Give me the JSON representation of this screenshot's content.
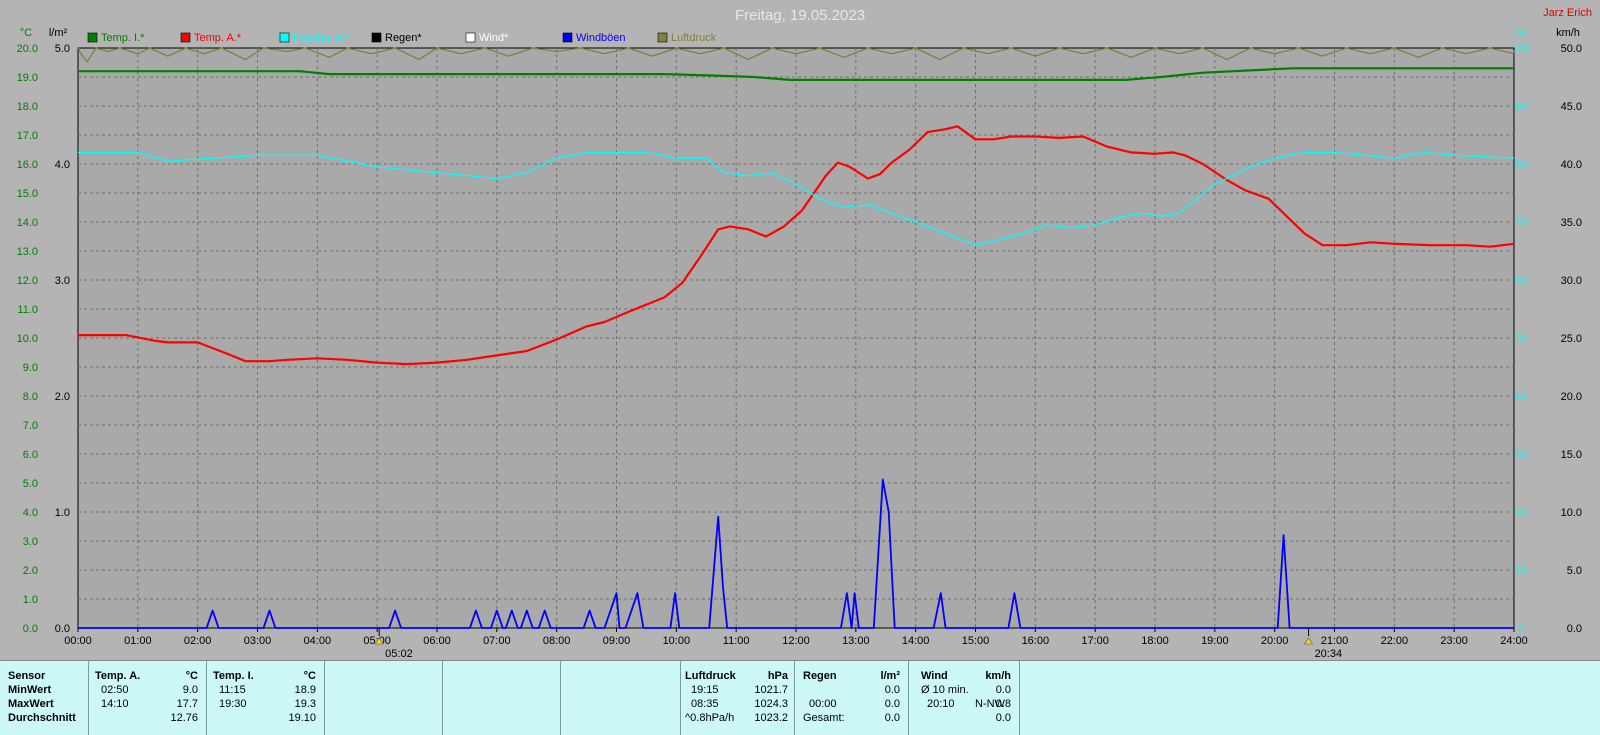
{
  "title": "Freitag, 19.05.2023",
  "credit": "Jarz Erich",
  "units": {
    "left_outer": "°C",
    "left_inner": "l/m²",
    "right_inner": "%",
    "right_outer": "km/h"
  },
  "legend": [
    {
      "label": "Temp. I.*",
      "color": "#008000"
    },
    {
      "label": "Temp. A.*",
      "color": "#ff0000"
    },
    {
      "label": "Feuchte A.*",
      "color": "#00ffff"
    },
    {
      "label": "Regen*",
      "color": "#000000"
    },
    {
      "label": "Wind*",
      "color": "#ffffff"
    },
    {
      "label": "Windböen",
      "color": "#0000ff"
    },
    {
      "label": "Luftdruck",
      "color": "#808040"
    }
  ],
  "markers": {
    "sunrise": "05:02",
    "sunset": "20:34"
  },
  "chart_data": {
    "type": "line",
    "x_unit": "hours",
    "xlim": [
      0,
      24
    ],
    "x_ticks": [
      "00:00",
      "01:00",
      "02:00",
      "03:00",
      "04:00",
      "05:00",
      "06:00",
      "07:00",
      "08:00",
      "09:00",
      "10:00",
      "11:00",
      "12:00",
      "13:00",
      "14:00",
      "15:00",
      "16:00",
      "17:00",
      "18:00",
      "19:00",
      "20:00",
      "21:00",
      "22:00",
      "23:00",
      "24:00"
    ],
    "axes": {
      "temp": {
        "unit": "°C",
        "ylim": [
          0,
          20
        ],
        "ticks": [
          "0.0",
          "1.0",
          "2.0",
          "3.0",
          "4.0",
          "5.0",
          "6.0",
          "7.0",
          "8.0",
          "9.0",
          "10.0",
          "11.0",
          "12.0",
          "13.0",
          "14.0",
          "15.0",
          "16.0",
          "17.0",
          "18.0",
          "19.0",
          "20.0"
        ]
      },
      "rain": {
        "unit": "l/m²",
        "ylim": [
          0,
          5
        ],
        "ticks": [
          "0.0",
          "1.0",
          "2.0",
          "3.0",
          "4.0",
          "5.0"
        ]
      },
      "humidity": {
        "unit": "%",
        "ylim": [
          0,
          100
        ],
        "ticks": [
          "0",
          "10",
          "20",
          "30",
          "40",
          "50",
          "60",
          "70",
          "80",
          "90",
          "100"
        ]
      },
      "wind": {
        "unit": "km/h",
        "ylim": [
          0,
          50
        ],
        "ticks": [
          "0.0",
          "5.0",
          "10.0",
          "15.0",
          "20.0",
          "25.0",
          "30.0",
          "35.0",
          "40.0",
          "45.0",
          "50.0"
        ]
      }
    },
    "grid": true,
    "series": [
      {
        "name": "Temp. I.*",
        "axis": "temp",
        "color": "#008000",
        "points": [
          [
            0,
            19.2
          ],
          [
            3.7,
            19.2
          ],
          [
            4.2,
            19.1
          ],
          [
            9.8,
            19.1
          ],
          [
            10.6,
            19.05
          ],
          [
            11.3,
            19.0
          ],
          [
            11.9,
            18.9
          ],
          [
            17.5,
            18.9
          ],
          [
            18.1,
            19.0
          ],
          [
            18.8,
            19.15
          ],
          [
            20.3,
            19.3
          ],
          [
            24,
            19.3
          ]
        ]
      },
      {
        "name": "Temp. A.*",
        "axis": "temp",
        "color": "#ff0000",
        "points": [
          [
            0,
            10.1
          ],
          [
            0.8,
            10.1
          ],
          [
            1.3,
            9.9
          ],
          [
            1.5,
            9.85
          ],
          [
            2.0,
            9.85
          ],
          [
            2.5,
            9.45
          ],
          [
            2.8,
            9.2
          ],
          [
            3.2,
            9.2
          ],
          [
            3.5,
            9.25
          ],
          [
            4.0,
            9.3
          ],
          [
            4.5,
            9.25
          ],
          [
            5.0,
            9.15
          ],
          [
            5.5,
            9.1
          ],
          [
            6.0,
            9.15
          ],
          [
            6.5,
            9.25
          ],
          [
            7.0,
            9.4
          ],
          [
            7.5,
            9.55
          ],
          [
            8.0,
            9.95
          ],
          [
            8.5,
            10.4
          ],
          [
            8.8,
            10.55
          ],
          [
            9.2,
            10.9
          ],
          [
            9.5,
            11.15
          ],
          [
            9.8,
            11.4
          ],
          [
            10.1,
            11.9
          ],
          [
            10.4,
            12.8
          ],
          [
            10.7,
            13.75
          ],
          [
            10.9,
            13.85
          ],
          [
            11.2,
            13.75
          ],
          [
            11.5,
            13.5
          ],
          [
            11.8,
            13.85
          ],
          [
            12.1,
            14.4
          ],
          [
            12.5,
            15.6
          ],
          [
            12.7,
            16.05
          ],
          [
            12.9,
            15.9
          ],
          [
            13.2,
            15.5
          ],
          [
            13.4,
            15.65
          ],
          [
            13.6,
            16.05
          ],
          [
            13.9,
            16.5
          ],
          [
            14.2,
            17.1
          ],
          [
            14.5,
            17.2
          ],
          [
            14.7,
            17.3
          ],
          [
            15.0,
            16.85
          ],
          [
            15.3,
            16.85
          ],
          [
            15.6,
            16.95
          ],
          [
            16.0,
            16.95
          ],
          [
            16.4,
            16.9
          ],
          [
            16.8,
            16.95
          ],
          [
            17.2,
            16.6
          ],
          [
            17.6,
            16.4
          ],
          [
            18.0,
            16.35
          ],
          [
            18.3,
            16.4
          ],
          [
            18.5,
            16.3
          ],
          [
            18.8,
            16.0
          ],
          [
            19.2,
            15.45
          ],
          [
            19.5,
            15.1
          ],
          [
            19.9,
            14.8
          ],
          [
            20.2,
            14.2
          ],
          [
            20.5,
            13.6
          ],
          [
            20.8,
            13.2
          ],
          [
            21.2,
            13.2
          ],
          [
            21.6,
            13.3
          ],
          [
            22.0,
            13.25
          ],
          [
            22.6,
            13.2
          ],
          [
            23.2,
            13.2
          ],
          [
            23.6,
            13.15
          ],
          [
            24.0,
            13.25
          ]
        ]
      },
      {
        "name": "Feuchte A.*",
        "axis": "humidity",
        "color": "#00ffff",
        "points": [
          [
            0,
            82
          ],
          [
            1.0,
            82
          ],
          [
            1.5,
            80.5
          ],
          [
            3.0,
            81.5
          ],
          [
            4.0,
            81.5
          ],
          [
            5.0,
            79.5
          ],
          [
            6.0,
            78.5
          ],
          [
            6.5,
            78
          ],
          [
            7.0,
            77.5
          ],
          [
            7.5,
            78.5
          ],
          [
            8.0,
            81
          ],
          [
            8.5,
            82
          ],
          [
            9.0,
            82
          ],
          [
            9.5,
            82
          ],
          [
            10.0,
            81
          ],
          [
            10.5,
            81
          ],
          [
            10.8,
            78.5
          ],
          [
            11.2,
            78
          ],
          [
            11.6,
            78.5
          ],
          [
            12.0,
            76.5
          ],
          [
            12.4,
            74
          ],
          [
            12.8,
            72.5
          ],
          [
            13.2,
            73
          ],
          [
            13.6,
            71.5
          ],
          [
            14.0,
            70
          ],
          [
            14.5,
            68
          ],
          [
            15.0,
            66
          ],
          [
            15.4,
            67
          ],
          [
            15.8,
            68
          ],
          [
            16.2,
            69.5
          ],
          [
            16.6,
            69
          ],
          [
            17.0,
            69.5
          ],
          [
            17.5,
            71
          ],
          [
            17.8,
            71.5
          ],
          [
            18.1,
            71
          ],
          [
            18.4,
            71.5
          ],
          [
            18.7,
            74
          ],
          [
            19.0,
            76.5
          ],
          [
            19.3,
            78
          ],
          [
            19.6,
            79.5
          ],
          [
            20.0,
            81
          ],
          [
            20.5,
            82
          ],
          [
            21.0,
            82
          ],
          [
            21.5,
            81.5
          ],
          [
            22.0,
            81
          ],
          [
            22.5,
            82
          ],
          [
            23.0,
            81.5
          ],
          [
            24.0,
            81
          ]
        ]
      },
      {
        "name": "Luftdruck",
        "axis": "rain",
        "color": "#808040",
        "points": [
          [
            0,
            5.0
          ],
          [
            0.05,
            4.95
          ],
          [
            0.15,
            4.88
          ],
          [
            0.3,
            5.0
          ],
          [
            0.5,
            4.97
          ],
          [
            0.7,
            5.0
          ],
          [
            1.0,
            4.95
          ],
          [
            1.2,
            5.0
          ],
          [
            1.5,
            4.93
          ],
          [
            1.8,
            5.0
          ],
          [
            2.1,
            4.95
          ],
          [
            2.4,
            5.0
          ],
          [
            2.8,
            4.9
          ],
          [
            3.1,
            5.0
          ],
          [
            3.5,
            4.97
          ],
          [
            3.8,
            5.0
          ],
          [
            4.2,
            4.92
          ],
          [
            4.5,
            5.0
          ],
          [
            4.9,
            4.95
          ],
          [
            5.3,
            5.0
          ],
          [
            5.7,
            4.9
          ],
          [
            6.0,
            5.0
          ],
          [
            6.4,
            4.95
          ],
          [
            6.8,
            5.0
          ],
          [
            7.2,
            4.93
          ],
          [
            7.6,
            5.0
          ],
          [
            8.0,
            4.97
          ],
          [
            8.4,
            5.0
          ],
          [
            8.8,
            4.95
          ],
          [
            9.2,
            5.0
          ],
          [
            9.6,
            4.93
          ],
          [
            10.0,
            5.0
          ],
          [
            10.4,
            4.95
          ],
          [
            10.8,
            5.0
          ],
          [
            11.2,
            4.9
          ],
          [
            11.6,
            5.0
          ],
          [
            12.0,
            4.95
          ],
          [
            12.4,
            5.0
          ],
          [
            12.8,
            4.92
          ],
          [
            13.2,
            5.0
          ],
          [
            13.6,
            4.95
          ],
          [
            14.0,
            5.0
          ],
          [
            14.4,
            4.9
          ],
          [
            14.8,
            5.0
          ],
          [
            15.2,
            4.95
          ],
          [
            15.6,
            5.0
          ],
          [
            16.0,
            4.93
          ],
          [
            16.4,
            5.0
          ],
          [
            16.8,
            4.95
          ],
          [
            17.2,
            5.0
          ],
          [
            17.6,
            4.92
          ],
          [
            18.0,
            5.0
          ],
          [
            18.4,
            4.95
          ],
          [
            18.8,
            5.0
          ],
          [
            19.2,
            4.9
          ],
          [
            19.6,
            5.0
          ],
          [
            20.0,
            4.95
          ],
          [
            20.4,
            5.0
          ],
          [
            20.8,
            4.93
          ],
          [
            21.2,
            5.0
          ],
          [
            21.6,
            4.95
          ],
          [
            22.0,
            5.0
          ],
          [
            22.4,
            4.92
          ],
          [
            22.8,
            5.0
          ],
          [
            23.2,
            4.95
          ],
          [
            23.6,
            5.0
          ],
          [
            24.0,
            4.95
          ]
        ]
      },
      {
        "name": "Windböen",
        "axis": "wind",
        "color": "#0000ff",
        "points": [
          [
            0,
            0
          ],
          [
            2.15,
            0
          ],
          [
            2.25,
            1.5
          ],
          [
            2.35,
            0
          ],
          [
            3.1,
            0
          ],
          [
            3.2,
            1.5
          ],
          [
            3.3,
            0
          ],
          [
            5.2,
            0
          ],
          [
            5.3,
            1.5
          ],
          [
            5.4,
            0
          ],
          [
            6.55,
            0
          ],
          [
            6.65,
            1.5
          ],
          [
            6.75,
            0
          ],
          [
            6.9,
            0
          ],
          [
            7.0,
            1.5
          ],
          [
            7.1,
            0
          ],
          [
            7.15,
            0
          ],
          [
            7.25,
            1.5
          ],
          [
            7.35,
            0
          ],
          [
            7.4,
            0
          ],
          [
            7.5,
            1.5
          ],
          [
            7.6,
            0
          ],
          [
            7.7,
            0
          ],
          [
            7.8,
            1.5
          ],
          [
            7.9,
            0
          ],
          [
            8.45,
            0
          ],
          [
            8.55,
            1.5
          ],
          [
            8.65,
            0
          ],
          [
            8.8,
            0
          ],
          [
            9.0,
            3.0
          ],
          [
            9.05,
            0
          ],
          [
            9.15,
            0
          ],
          [
            9.35,
            3.0
          ],
          [
            9.45,
            0
          ],
          [
            9.9,
            0
          ],
          [
            9.98,
            3.0
          ],
          [
            10.05,
            0
          ],
          [
            10.55,
            0
          ],
          [
            10.7,
            9.6
          ],
          [
            10.78,
            3.5
          ],
          [
            10.85,
            0
          ],
          [
            12.75,
            0
          ],
          [
            12.85,
            3.0
          ],
          [
            12.93,
            0
          ],
          [
            12.98,
            3.0
          ],
          [
            13.05,
            0
          ],
          [
            13.3,
            0
          ],
          [
            13.45,
            12.8
          ],
          [
            13.55,
            10.0
          ],
          [
            13.65,
            0
          ],
          [
            14.3,
            0
          ],
          [
            14.42,
            3.0
          ],
          [
            14.5,
            0
          ],
          [
            15.55,
            0
          ],
          [
            15.65,
            3.0
          ],
          [
            15.75,
            0
          ],
          [
            20.05,
            0
          ],
          [
            20.15,
            8.0
          ],
          [
            20.25,
            0
          ],
          [
            24,
            0
          ]
        ]
      }
    ]
  },
  "stats": {
    "sensor_header": "Sensor",
    "row_labels": [
      "MinWert",
      "MaxWert",
      "Durchschnitt"
    ],
    "temp_a": {
      "header": "Temp. A.",
      "unit": "°C",
      "min_time": "02:50",
      "min": "9.0",
      "max_time": "14:10",
      "max": "17.7",
      "avg": "12.76"
    },
    "temp_i": {
      "header": "Temp. I.",
      "unit": "°C",
      "min_time": "11:15",
      "min": "18.9",
      "max_time": "19:30",
      "max": "19.3",
      "avg": "19.10"
    },
    "pressure": {
      "header": "Luftdruck",
      "unit": "hPa",
      "r1_time": "19:15",
      "r1": "1021.7",
      "r2_time": "08:35",
      "r2": "1024.3",
      "r3_label": "^0.8hPa/h",
      "r3": "1023.2"
    },
    "rain": {
      "header": "Regen",
      "unit": "l/m²",
      "r2_time": "00:00",
      "r2": "0.0",
      "r1": "0.0",
      "r3_label": "Gesamt:",
      "r3": "0.0"
    },
    "wind": {
      "header": "Wind",
      "unit": "km/h",
      "r1_label": "Ø 10 min.",
      "r1": "0.0",
      "r2_time": "20:10",
      "r2_dir": "N-NW",
      "r2": "0.8",
      "r3": "0.0"
    }
  }
}
